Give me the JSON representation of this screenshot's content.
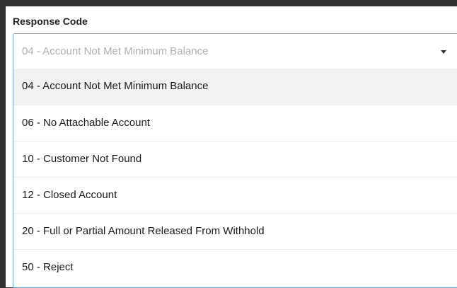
{
  "field": {
    "label": "Response Code",
    "selected_value": "04 - Account Not Met Minimum Balance"
  },
  "icons": {
    "dropdown": "caret-down-icon"
  },
  "options": [
    {
      "label": "04 - Account Not Met Minimum Balance",
      "selected": true
    },
    {
      "label": "06 - No Attachable Account",
      "selected": false
    },
    {
      "label": "10 - Customer Not Found",
      "selected": false
    },
    {
      "label": "12 - Closed Account",
      "selected": false
    },
    {
      "label": "20 - Full or Partial Amount Released From Withhold",
      "selected": false
    },
    {
      "label": "50 - Reject",
      "selected": false
    }
  ],
  "colors": {
    "focus_border": "#6aa8e0",
    "highlight_bg": "#f2f2f2",
    "page_bg": "#323232"
  }
}
